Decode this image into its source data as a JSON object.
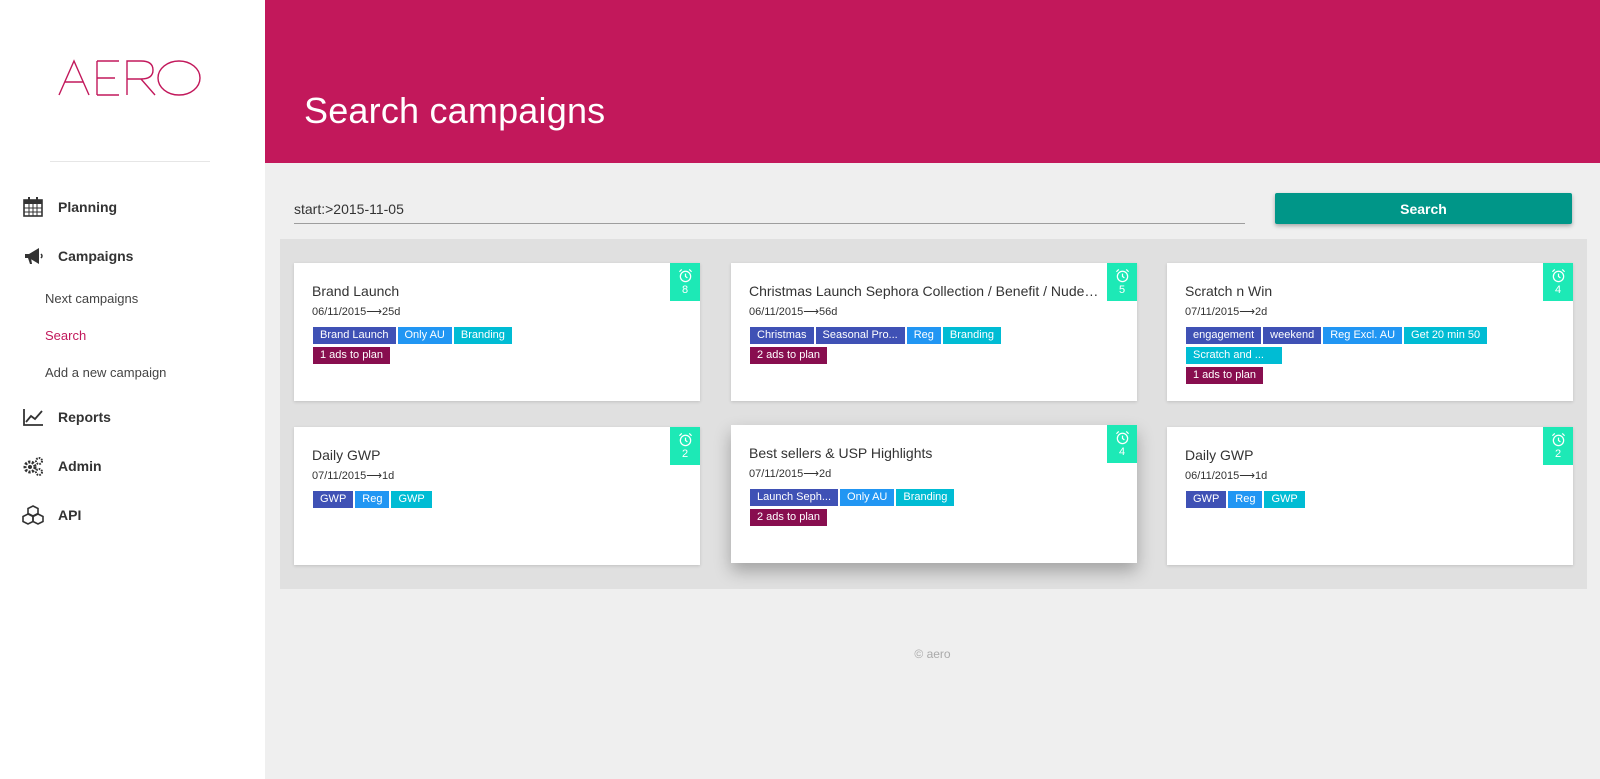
{
  "app": {
    "logo_text": "AERO",
    "brand_color": "#c2185b",
    "accent_color": "#009688"
  },
  "sidebar": {
    "items": [
      {
        "label": "Planning",
        "icon": "calendar-icon"
      },
      {
        "label": "Campaigns",
        "icon": "megaphone-icon",
        "sub_items": [
          {
            "label": "Next campaigns",
            "active": false
          },
          {
            "label": "Search",
            "active": true
          },
          {
            "label": "Add a new campaign",
            "active": false
          }
        ]
      },
      {
        "label": "Reports",
        "icon": "chart-icon"
      },
      {
        "label": "Admin",
        "icon": "gears-icon"
      },
      {
        "label": "API",
        "icon": "cubes-icon"
      }
    ]
  },
  "header": {
    "title": "Search campaigns"
  },
  "search": {
    "value": "start:>2015-11-05",
    "button_label": "Search"
  },
  "tag_colors": {
    "indigo": "#3f51b5",
    "blue": "#2196f3",
    "cyan": "#00bcd4",
    "ads": "#880e4f",
    "badge": "#1de9b6"
  },
  "cards": [
    {
      "title": "Brand Launch",
      "dates": "06/11/2015⟶25d",
      "tags": [
        "Brand Launch",
        "Only AU",
        "Branding"
      ],
      "extra": "1 ads to plan",
      "alarm_count": "8"
    },
    {
      "title": "Christmas Launch Sephora Collection / Benefit / Nudestix",
      "dates": "06/11/2015⟶56d",
      "tags": [
        "Christmas",
        "Seasonal Pro...",
        "Reg",
        "Branding"
      ],
      "extra": "2 ads to plan",
      "alarm_count": "5"
    },
    {
      "title": "Scratch n Win",
      "dates": "07/11/2015⟶2d",
      "tags": [
        "engagement",
        "weekend",
        "Reg Excl. AU",
        "Get 20 min 50",
        "Scratch and ..."
      ],
      "extra": "1 ads to plan",
      "alarm_count": "4"
    },
    {
      "title": "Daily GWP",
      "dates": "07/11/2015⟶1d",
      "tags": [
        "GWP",
        "Reg",
        "GWP"
      ],
      "extra": "",
      "alarm_count": "2"
    },
    {
      "title": "Best sellers & USP Highlights",
      "dates": "07/11/2015⟶2d",
      "tags": [
        "Launch Seph...",
        "Only AU",
        "Branding"
      ],
      "extra": "2 ads to plan",
      "alarm_count": "4"
    },
    {
      "title": "Daily GWP",
      "dates": "06/11/2015⟶1d",
      "tags": [
        "GWP",
        "Reg",
        "GWP"
      ],
      "extra": "",
      "alarm_count": "2"
    }
  ],
  "footer": {
    "text": "© aero"
  }
}
